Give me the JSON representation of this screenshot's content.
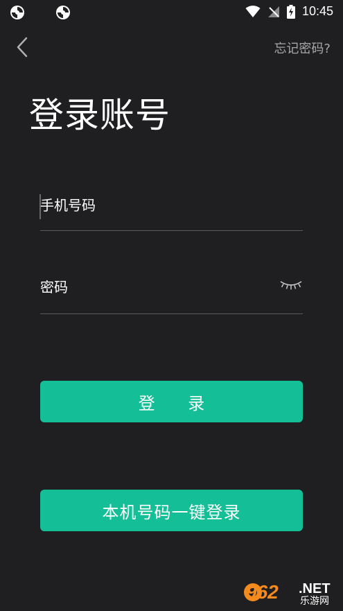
{
  "status_bar": {
    "time": "10:45",
    "icons": [
      "app-notification-icon",
      "app-notification-icon",
      "wifi-icon",
      "signal-off-icon",
      "battery-charging-icon"
    ]
  },
  "header": {
    "back_icon": "chevron-left-icon",
    "forgot_password": "忘记密码?"
  },
  "title": "登录账号",
  "form": {
    "phone_placeholder": "手机号码",
    "password_placeholder": "密码",
    "password_toggle_icon": "eye-closed-icon"
  },
  "buttons": {
    "login": "登 录",
    "one_key_login": "本机号码一键登录"
  },
  "watermark": {
    "number": "962",
    "domain": ".NET",
    "cn": "乐游网"
  },
  "colors": {
    "background": "#1f1f21",
    "accent": "#14be97",
    "muted_text": "#a8a8ac",
    "watermark_orange": "#f28a1e"
  }
}
